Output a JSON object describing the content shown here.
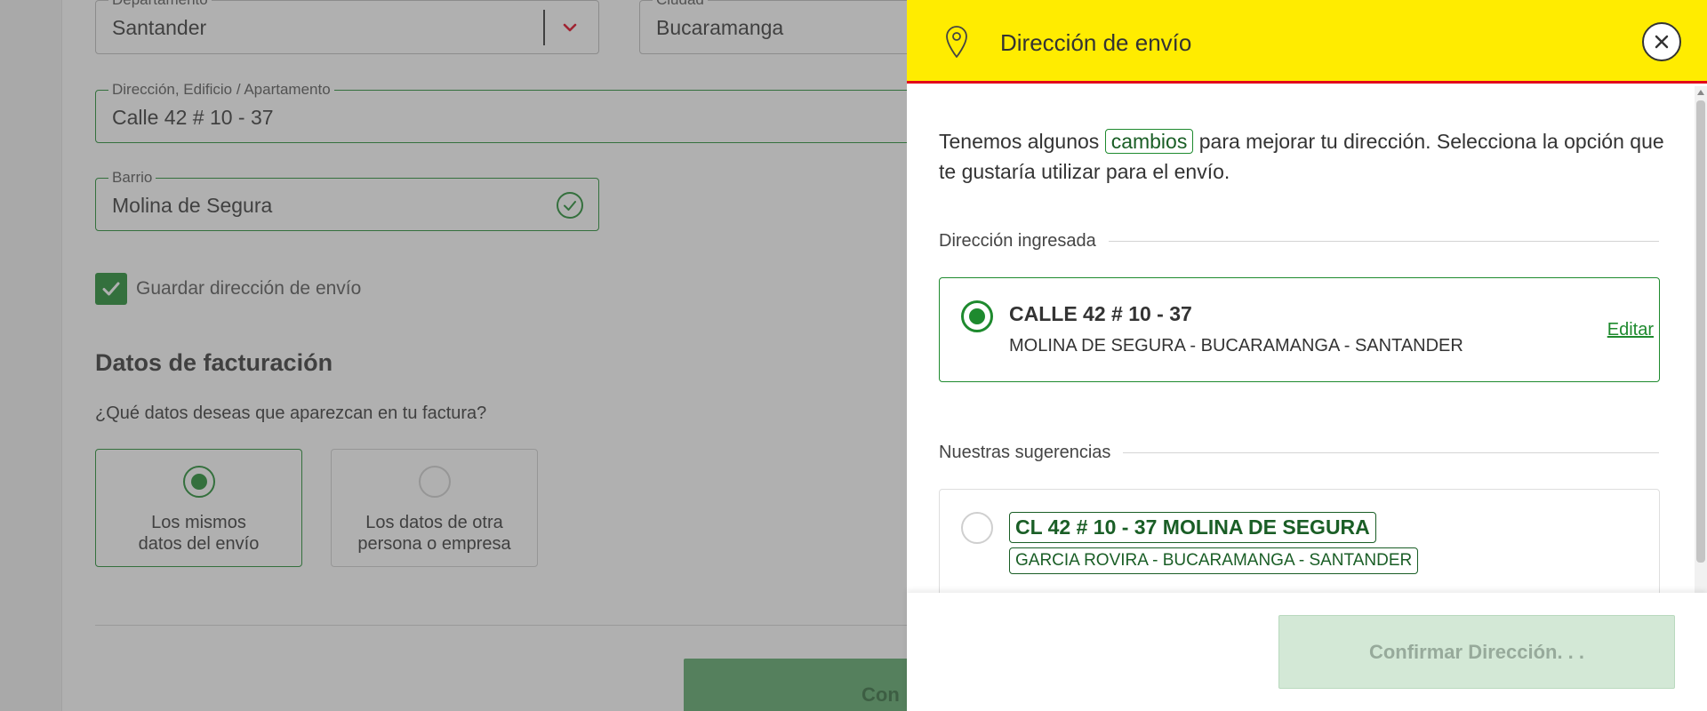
{
  "form": {
    "department": {
      "label": "Departamento",
      "value": "Santander"
    },
    "city": {
      "label": "Ciudad",
      "value": "Bucaramanga"
    },
    "address": {
      "label": "Dirección, Edificio / Apartamento",
      "value": "Calle 42 # 10 - 37"
    },
    "neighborhood": {
      "label": "Barrio",
      "value": "Molina de Segura"
    },
    "save_address_label": "Guardar dirección de envío",
    "billing_title": "Datos de facturación",
    "billing_question": "¿Qué datos deseas que aparezcan en tu factura?",
    "billing_options": [
      {
        "line1": "Los mismos",
        "line2": "datos del envío",
        "selected": true
      },
      {
        "line1": "Los datos de otra",
        "line2": "persona o empresa",
        "selected": false
      }
    ],
    "continue_label": "Con"
  },
  "drawer": {
    "title": "Dirección de envío",
    "intro_before": "Tenemos algunos",
    "intro_highlight": "cambios",
    "intro_after": "para mejorar tu dirección. Selecciona la opción que te gustaría utilizar para el envío.",
    "entered_section": "Dirección ingresada",
    "entered": {
      "main": "CALLE 42 # 10 - 37",
      "sub": "MOLINA DE SEGURA - BUCARAMANGA - SANTANDER",
      "edit_label": "Editar",
      "selected": true
    },
    "suggestions_section": "Nuestras sugerencias",
    "suggestion": {
      "main": "CL 42 # 10 - 37 MOLINA DE SEGURA",
      "sub": "GARCIA ROVIRA - BUCARAMANGA - SANTANDER",
      "selected": false
    },
    "confirm_label": "Confirmar Dirección. . ."
  },
  "colors": {
    "header_bg": "#ffec00",
    "header_border": "#e2001a",
    "accent_green": "#1e8a2e",
    "suggestion_green": "#1a5e26",
    "confirm_disabled_bg": "#d3e8d6"
  },
  "icons": [
    "chevron-down-icon",
    "check-circle-icon",
    "checkbox-check-icon",
    "location-pin-icon",
    "close-icon"
  ]
}
